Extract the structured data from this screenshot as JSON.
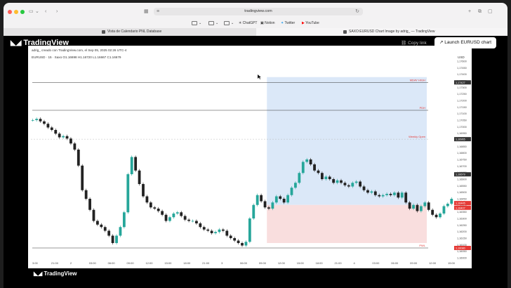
{
  "browser": {
    "url": "tradingview.com",
    "bookmarks": [
      "ChatGPT",
      "Notion",
      "Twitter",
      "YouTube"
    ],
    "tabs": [
      {
        "label": "Vista de Calendario PNL Database"
      },
      {
        "label": "SAXO:EURUSD Chart Image by adrig_ — TradingView"
      }
    ]
  },
  "header": {
    "logo": "TradingView",
    "copy_link": "Copy link",
    "launch_button": "Launch EURUSD chart"
  },
  "chart_meta": {
    "author_line": "adrig_ creado con TradingView.com, el Sep 05, 2025 02:26 UTC-4",
    "symbol_line": "EURUSD · 15 · Saxo  O1.16698 H1.16720 L1.16667 C1.16679",
    "currency": "USD"
  },
  "footer": {
    "logo": "TradingView"
  },
  "colors": {
    "bull": "#26a69a",
    "bear": "#222222",
    "range_blue": "#dbe8f8",
    "range_red": "#f9dede",
    "label_red": "#e53935"
  },
  "chart_data": {
    "type": "line",
    "y_ticks": [
      "1,17600",
      "1,17450",
      "1,17400",
      "1,17350",
      "1,17300",
      "1,17250",
      "1,17200",
      "1,17150",
      "1,17100",
      "1,17050",
      "1,17000",
      "1,16950",
      "1,16900",
      "1,16850",
      "1,16800",
      "1,16750",
      "1,16700",
      "1,16650",
      "1,16600",
      "1,16550",
      "1,16500",
      "1,16450",
      "1,16400",
      "1,16350",
      "1,16300",
      "1,16250",
      "1,16200",
      "1,16150",
      "1,16100",
      "1,16050",
      "1,16000"
    ],
    "x_ticks": [
      "3:00",
      "21:00",
      "2",
      "03:00",
      "06:00",
      "09:00",
      "12:00",
      "15:00",
      "18:00",
      "21:00",
      "3",
      "06:00",
      "09:00",
      "12:00",
      "15:00",
      "18:00",
      "21:00",
      "4",
      "03:00",
      "06:00",
      "09:00",
      "12:00",
      "15:00"
    ],
    "levels": [
      {
        "label": "MDAY HIGH",
        "price": 1.17425
      },
      {
        "label": "PDH",
        "price": 1.172
      },
      {
        "label": "Weekly Open",
        "price": 1.16965
      },
      {
        "label": "PWL",
        "price": 1.1608
      }
    ],
    "price_tags": [
      "1,17427",
      "1,16965",
      "1,16679",
      "1,16445",
      "1,16407",
      "1,16080"
    ],
    "ylim": [
      1.16,
      1.176
    ],
    "close_series": [
      1.1712,
      1.1713,
      1.1711,
      1.1709,
      1.1706,
      1.1704,
      1.1701,
      1.1698,
      1.1699,
      1.1697,
      1.1693,
      1.1688,
      1.1675,
      1.1655,
      1.1648,
      1.1639,
      1.163,
      1.1627,
      1.1625,
      1.1622,
      1.1618,
      1.1612,
      1.1618,
      1.1625,
      1.1637,
      1.1668,
      1.1682,
      1.1671,
      1.166,
      1.165,
      1.1645,
      1.1641,
      1.164,
      1.1638,
      1.1635,
      1.163,
      1.1633,
      1.1636,
      1.1637,
      1.1634,
      1.1631,
      1.163,
      1.163,
      1.1628,
      1.1625,
      1.1623,
      1.1622,
      1.162,
      1.1621,
      1.1623,
      1.1622,
      1.1618,
      1.1616,
      1.1614,
      1.1612,
      1.161,
      1.1613,
      1.1632,
      1.1643,
      1.1651,
      1.1646,
      1.1641,
      1.164,
      1.1645,
      1.165,
      1.1648,
      1.1645,
      1.1651,
      1.1657,
      1.1661,
      1.1669,
      1.1678,
      1.168,
      1.1676,
      1.1671,
      1.1669,
      1.1664,
      1.1666,
      1.1664,
      1.1661,
      1.1663,
      1.1661,
      1.1659,
      1.1658,
      1.1661,
      1.1662,
      1.1658,
      1.1655,
      1.1653,
      1.1654,
      1.1651,
      1.165,
      1.1651,
      1.1652,
      1.1651,
      1.1653,
      1.1649,
      1.1653,
      1.1645,
      1.164,
      1.1643,
      1.1638,
      1.1642,
      1.1645,
      1.1639,
      1.1635,
      1.1633,
      1.1636,
      1.1642,
      1.1644,
      1.1648
    ]
  }
}
